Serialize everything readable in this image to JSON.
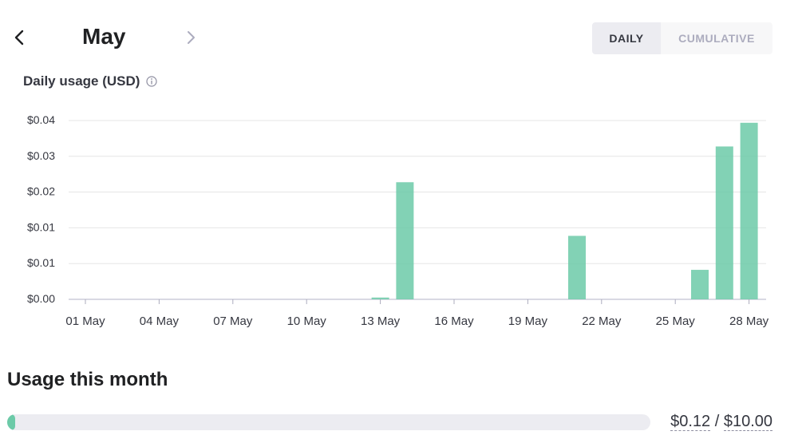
{
  "header": {
    "month": "May",
    "toggle": {
      "daily_label": "DAILY",
      "cumulative_label": "CUMULATIVE",
      "selected": "daily"
    }
  },
  "chart_label": "Daily usage (USD)",
  "chart_data": {
    "type": "bar",
    "x": [
      1,
      2,
      3,
      4,
      5,
      6,
      7,
      8,
      9,
      10,
      11,
      12,
      13,
      14,
      15,
      16,
      17,
      18,
      19,
      20,
      21,
      22,
      23,
      24,
      25,
      26,
      27,
      28
    ],
    "values": [
      0,
      0,
      0,
      0,
      0,
      0,
      0,
      0,
      0,
      0,
      0,
      0,
      0.0004,
      0.0262,
      0,
      0,
      0,
      0,
      0,
      0,
      0.0142,
      0,
      0,
      0,
      0,
      0.0066,
      0.0342,
      0.0395
    ],
    "xticks": [
      {
        "x": 1,
        "label": "01 May"
      },
      {
        "x": 4,
        "label": "04 May"
      },
      {
        "x": 7,
        "label": "07 May"
      },
      {
        "x": 10,
        "label": "10 May"
      },
      {
        "x": 13,
        "label": "13 May"
      },
      {
        "x": 16,
        "label": "16 May"
      },
      {
        "x": 19,
        "label": "19 May"
      },
      {
        "x": 22,
        "label": "22 May"
      },
      {
        "x": 25,
        "label": "25 May"
      },
      {
        "x": 28,
        "label": "28 May"
      }
    ],
    "yticks": [
      {
        "y": 0,
        "label": "$0.00"
      },
      {
        "y": 0.008,
        "label": "$0.01"
      },
      {
        "y": 0.016,
        "label": "$0.01"
      },
      {
        "y": 0.024,
        "label": "$0.02"
      },
      {
        "y": 0.032,
        "label": "$0.03"
      },
      {
        "y": 0.04,
        "label": "$0.04"
      }
    ],
    "ylim": [
      0,
      0.04
    ],
    "grid": true,
    "bar_color": "#6ccaa8"
  },
  "usage": {
    "title": "Usage this month",
    "used": "$0.12",
    "separator": " / ",
    "limit": "$10.00",
    "fraction": 0.012
  },
  "colors": {
    "accent": "#6ccaa8",
    "track": "#ececf1",
    "grid": "#e5e5e5"
  },
  "icons": {
    "prev": "chevron-left-icon",
    "next": "chevron-right-icon",
    "info": "info-icon"
  }
}
